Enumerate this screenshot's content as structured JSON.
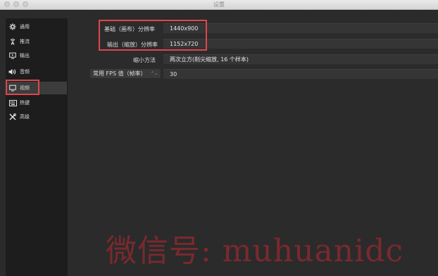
{
  "window": {
    "title": "设置"
  },
  "sidebar": {
    "items": [
      {
        "label": "通用",
        "icon": "gear-icon"
      },
      {
        "label": "推流",
        "icon": "broadcast-icon"
      },
      {
        "label": "输出",
        "icon": "output-icon"
      },
      {
        "label": "音频",
        "icon": "speaker-icon"
      },
      {
        "label": "视频",
        "icon": "monitor-icon",
        "active": true
      },
      {
        "label": "热键",
        "icon": "keyboard-icon"
      },
      {
        "label": "高级",
        "icon": "tools-icon"
      }
    ]
  },
  "video": {
    "base_resolution_label": "基础（画布）分辨率",
    "base_resolution_value": "1440x900",
    "output_resolution_label": "输出（缩放）分辨率",
    "output_resolution_value": "1152x720",
    "downscale_filter_label": "缩小方法",
    "downscale_filter_value": "两次立方(削尖缩放, 16 个样本)",
    "fps_mode_label": "常用 FPS 值（帧率）",
    "fps_value": "30"
  },
  "watermark": {
    "text": "微信号: muhuanidc"
  },
  "colors": {
    "highlight": "#e0454c",
    "sidebar_bg": "#1d1d1d",
    "main_bg": "#2b2b2b"
  }
}
